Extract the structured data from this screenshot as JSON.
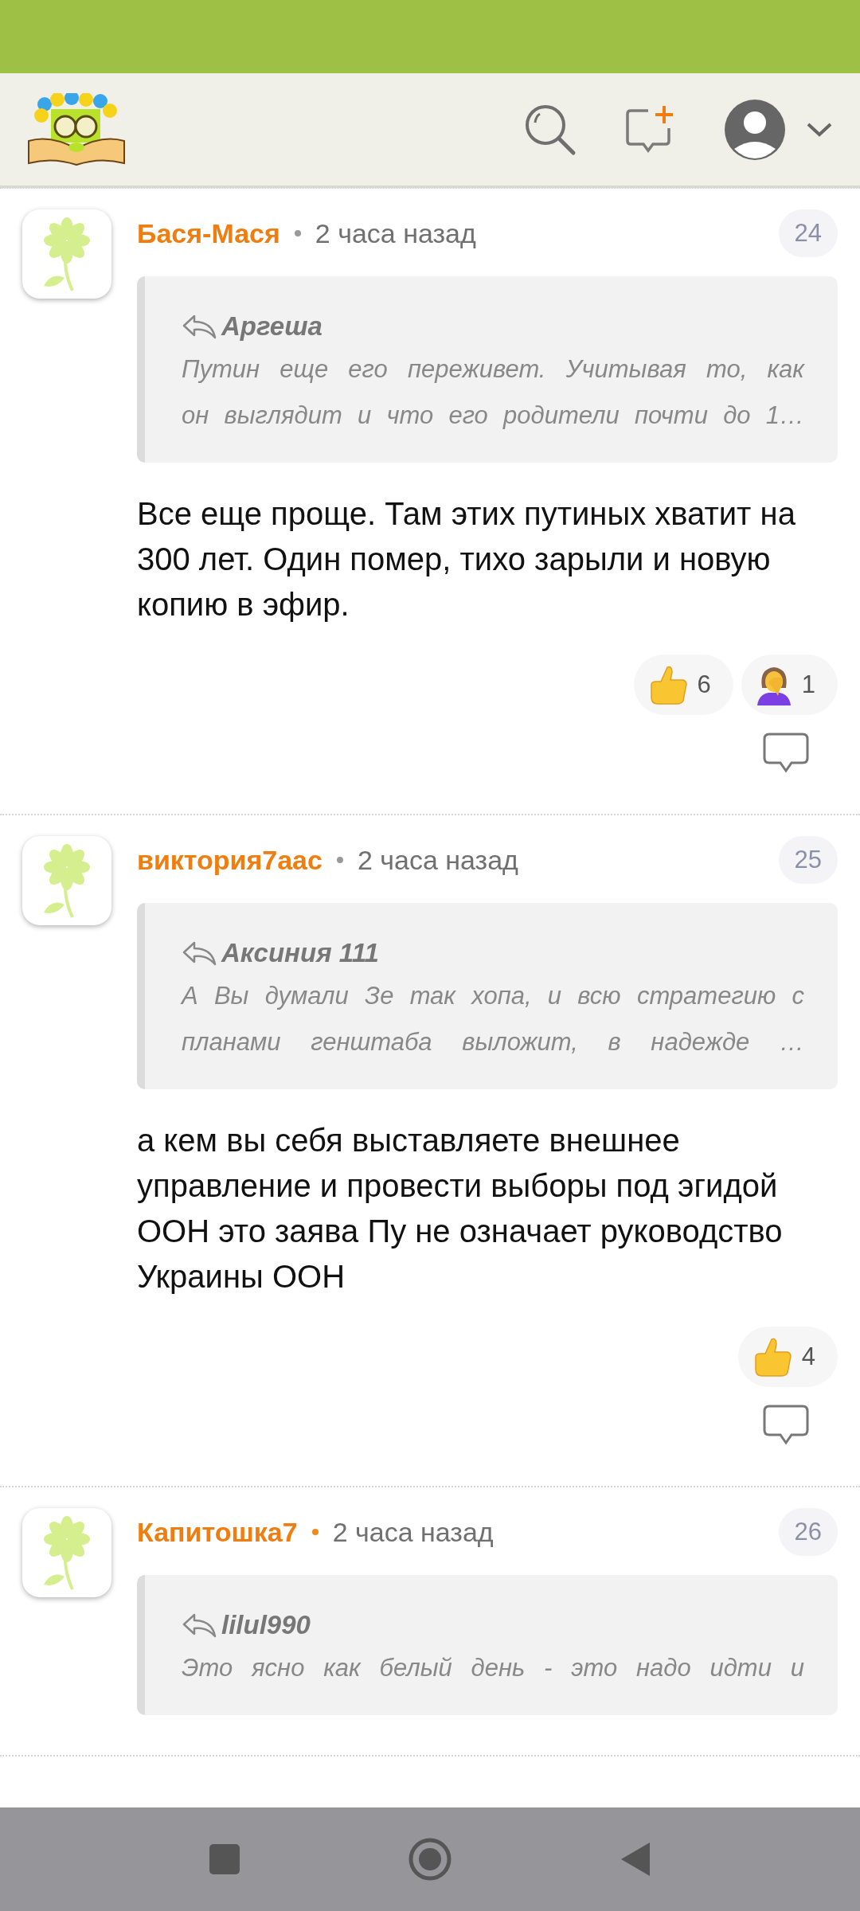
{
  "comments": [
    {
      "author": "Бася-Мася",
      "color": "#9a9a9a",
      "time": "2 часа назад",
      "number": "24",
      "quote": {
        "author": "Аргеша",
        "lines": [
          "Путин еще его переживет. Учитывая то, как",
          "он выглядит и что его родители почти до 1…"
        ]
      },
      "text": "Все еще проще. Там этих путиных хватит на 300 лет. Один помер, тихо зарыли и новую копию в эфир.",
      "reactions": [
        {
          "kind": "like",
          "count": "6"
        },
        {
          "kind": "facepalm",
          "count": "1"
        }
      ]
    },
    {
      "author": "виктория7аас",
      "color": "#9a9a9a",
      "time": "2 часа назад",
      "number": "25",
      "quote": {
        "author": "Аксиния 111",
        "lines": [
          "А Вы думали Зе так хопа, и всю стратегию с",
          "планами генштаба выложит, в надежде …"
        ]
      },
      "text": "а кем вы себя выставляете внешнее управление и провести выборы под эгидой ООН это заява Пу не означает руководство Украины ООН",
      "reactions": [
        {
          "kind": "like",
          "count": "4"
        }
      ]
    },
    {
      "author": "Капитошка7",
      "color": "#f08a1c",
      "time": "2 часа назад",
      "number": "26",
      "quote": {
        "author": "lilul990",
        "lines": [
          "Это ясно как белый день - это надо идти и"
        ]
      }
    }
  ]
}
